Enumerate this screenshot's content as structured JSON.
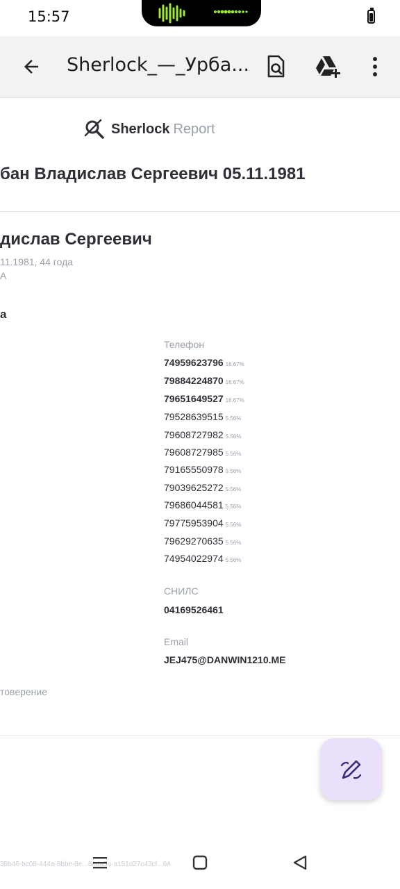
{
  "status": {
    "time": "15:57",
    "battery_level": 0.7
  },
  "toolbar": {
    "title": "Sherlock_—_Урба...",
    "icons": [
      "back-arrow-icon",
      "document-search-icon",
      "drive-add-icon",
      "more-vert-icon"
    ]
  },
  "report": {
    "logo_bold": "Sherlock",
    "logo_light": "Report",
    "title": "бан Владислав Сергеевич 05.11.1981",
    "name": "дислав Сергеевич",
    "birth_info": "11.1981, 44 года",
    "extra_line": "А",
    "section_heading": "а",
    "phone_label": "Телефон",
    "phones": [
      {
        "number": "74959623796",
        "pct": "16.67%",
        "bold": true
      },
      {
        "number": "79884224870",
        "pct": "16.67%",
        "bold": true
      },
      {
        "number": "79651649527",
        "pct": "16.67%",
        "bold": true
      },
      {
        "number": "79528639515",
        "pct": "5.56%",
        "bold": false
      },
      {
        "number": "79608727982",
        "pct": "5.56%",
        "bold": false
      },
      {
        "number": "79608727985",
        "pct": "5.56%",
        "bold": false
      },
      {
        "number": "79165550978",
        "pct": "5.56%",
        "bold": false
      },
      {
        "number": "79039625272",
        "pct": "5.56%",
        "bold": false
      },
      {
        "number": "79686044581",
        "pct": "5.56%",
        "bold": false
      },
      {
        "number": "79775953904",
        "pct": "5.56%",
        "bold": false
      },
      {
        "number": "79629270635",
        "pct": "5.56%",
        "bold": false
      },
      {
        "number": "74954022974",
        "pct": "5.56%",
        "bold": false
      }
    ],
    "snils_label": "СНИЛС",
    "snils_value": "04169526461",
    "email_label": "Email",
    "email_value": "JEJ475@DANWIN1210.ME",
    "id_doc_label": "товерение",
    "footer_hash": "39b46-bc08-444a-8bbe-8e...8eda5a-a151d27c43cf...6#"
  },
  "fab": {
    "icon": "edit-draw-icon",
    "color": "#ebe0fb"
  },
  "navbar": {
    "icons": [
      "menu-lines-icon",
      "home-square-icon",
      "back-triangle-icon"
    ]
  }
}
